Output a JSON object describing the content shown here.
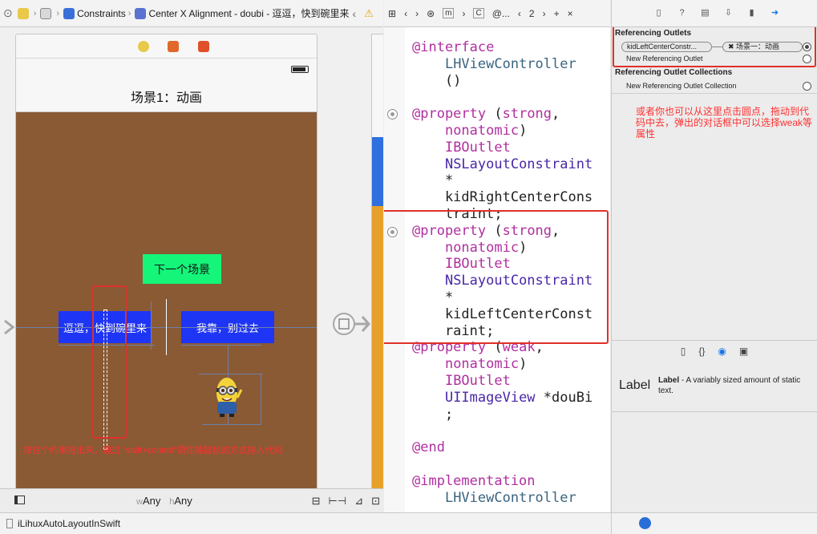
{
  "jumpbar": {
    "crumb_constraints": "Constraints",
    "crumb_alignment": "Center X Alignment - doubi - 逗逗，快到碗里来"
  },
  "scene": {
    "nav_title": "场景1：动画",
    "next_scene_button": "下一个场景",
    "left_button": "逗逗，快到碗里来",
    "right_button": "我靠，别过去",
    "annotation": "按住个约束拖出来，通过 \"shift+control\"调住随鼠标的方式拖入代码"
  },
  "sizebar": {
    "w_prefix": "w",
    "w_value": "Any",
    "h_prefix": "h",
    "h_value": "Any"
  },
  "status": {
    "project": "iLihuxAutoLayoutInSwift"
  },
  "editor_bar": {
    "file_m": "m",
    "file_at": "@...",
    "counter": "2",
    "plus": "+",
    "close": "×"
  },
  "code": {
    "lines": [
      "@interface",
      "    LHViewController",
      "    ()",
      "",
      "@property (strong,",
      "    nonatomic)",
      "    IBOutlet",
      "    NSLayoutConstraint",
      "    *",
      "    kidRightCenterCons",
      "    traint;",
      "@property (strong,",
      "    nonatomic)",
      "    IBOutlet",
      "    NSLayoutConstraint",
      "    *",
      "    kidLeftCenterConst",
      "    raint;",
      "@property (weak,",
      "    nonatomic)",
      "    IBOutlet",
      "    UIImageView *douBi",
      "    ;",
      "",
      "@end",
      "",
      "@implementation",
      "    LHViewController"
    ]
  },
  "inspector": {
    "referencing_outlets": "Referencing Outlets",
    "outlet_source": "kidLeftCenterConstr...",
    "outlet_target": "场景一：动画",
    "new_ref_outlet": "New Referencing Outlet",
    "ref_collections": "Referencing Outlet Collections",
    "new_ref_collection": "New Referencing Outlet Collection",
    "annotation": "或者你也可以从这里点击圆点，拖动到代码中去，弹出的对话框中可以选择weak等属性"
  },
  "library": {
    "item_big": "Label",
    "item_name": "Label",
    "item_desc": " - A variably sized amount of static text."
  },
  "colors": {
    "scene_bg": "#8a5a35",
    "green_button": "#14f57a",
    "blue_button": "#1f35f5",
    "annotation_red": "#ff3030",
    "keyword": "#b02fa0",
    "type": "#4a27a8"
  }
}
